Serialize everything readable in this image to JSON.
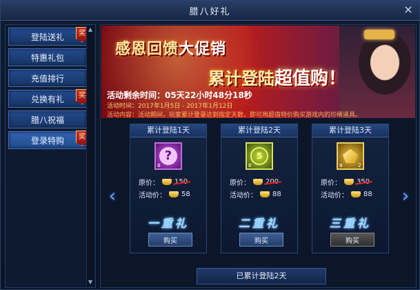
{
  "window": {
    "title": "腊八好礼",
    "close_label": "×"
  },
  "sidebar": {
    "items": [
      {
        "label": "登陆送礼",
        "badge": "奖"
      },
      {
        "label": "特惠礼包",
        "badge": ""
      },
      {
        "label": "充值排行",
        "badge": ""
      },
      {
        "label": "兑换有礼",
        "badge": "奖"
      },
      {
        "label": "腊八祝福",
        "badge": ""
      },
      {
        "label": "登录特购",
        "badge": "奖"
      }
    ],
    "scroll_up": "▲",
    "scroll_down": "▼"
  },
  "banner": {
    "title_line1": "感恩回馈",
    "title_line1_big": "大促销",
    "title_line2": "累计登陆",
    "title_line2_hl": "超值购！",
    "countdown": "活动剩余时间：05天22小时48分18秒",
    "period": "活动时间：2017年1月5日 - 2017年1月12日",
    "description": "活动内容：活动期间，玩家累计登录达到指定天数，即可用超值特价购买游戏内的珍稀道具。"
  },
  "cards": [
    {
      "header": "累计登陆1天",
      "icon": "question-orb",
      "glyph": "?",
      "qty": "",
      "tiny": "B",
      "orig_label": "原价：",
      "orig_price": "150",
      "sale_label": "活动价：",
      "sale_price": "58",
      "tier": "一重礼",
      "buy_label": "购买",
      "buy_disabled": false
    },
    {
      "header": "累计登陆2天",
      "icon": "coin-5",
      "glyph": "5",
      "qty": "",
      "tiny": "B",
      "orig_label": "原价：",
      "orig_price": "200",
      "sale_label": "活动价：",
      "sale_price": "88",
      "tier": "二重礼",
      "buy_label": "购买",
      "buy_disabled": false
    },
    {
      "header": "累计登陆3天",
      "icon": "gold-nugget",
      "glyph": "",
      "qty": "2",
      "tiny": "B",
      "orig_label": "原价：",
      "orig_price": "350",
      "sale_label": "活动价：",
      "sale_price": "88",
      "tier": "三重礼",
      "buy_label": "购买",
      "buy_disabled": true
    }
  ],
  "nav": {
    "prev": "‹",
    "next": "›"
  },
  "footer": {
    "status": "已累计登陆2天"
  },
  "colors": {
    "accent": "#244a8f",
    "badge": "#cc2e2e",
    "strike": "#e02020",
    "tier_glow": "#3a9cff"
  }
}
